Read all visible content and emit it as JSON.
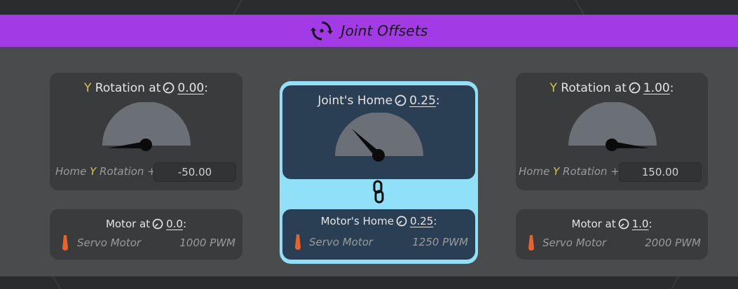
{
  "header": {
    "title": "Joint Offsets",
    "icon": "rotate-center-icon"
  },
  "left": {
    "rotation": {
      "prefix_axis": "Y",
      "text": "Rotation at",
      "value": "0.00",
      "suffix": ":"
    },
    "gauge": {
      "needle_angle_deg": 185
    },
    "home": {
      "label_pre": "Home",
      "axis": "Y",
      "label_post": "Rotation +",
      "value": "-50.00"
    },
    "motor": {
      "text": "Motor at",
      "value": "0.0",
      "suffix": ":",
      "type": "Servo Motor",
      "pwm": "1000 PWM"
    }
  },
  "center": {
    "joint": {
      "text": "Joint's Home",
      "value": "0.25",
      "suffix": ":"
    },
    "gauge": {
      "needle_angle_deg": 135
    },
    "motor": {
      "text": "Motor's Home",
      "value": "0.25",
      "suffix": ":",
      "type": "Servo Motor",
      "pwm": "1250 PWM"
    },
    "link_icon": "link-icon"
  },
  "right": {
    "rotation": {
      "prefix_axis": "Y",
      "text": "Rotation at",
      "value": "1.00",
      "suffix": ":"
    },
    "gauge": {
      "needle_angle_deg": 355
    },
    "home": {
      "label_pre": "Home",
      "axis": "Y",
      "label_post": "Rotation +",
      "value": "150.00"
    },
    "motor": {
      "text": "Motor at",
      "value": "1.0",
      "suffix": ":",
      "type": "Servo Motor",
      "pwm": "2000 PWM"
    }
  },
  "colors": {
    "header_bg": "#a23be6",
    "axis_yellow": "#d6c74a",
    "gauge_fill": "#6b7077",
    "center_highlight": "#8fe0f8",
    "motor_orange": "#e8622a"
  }
}
